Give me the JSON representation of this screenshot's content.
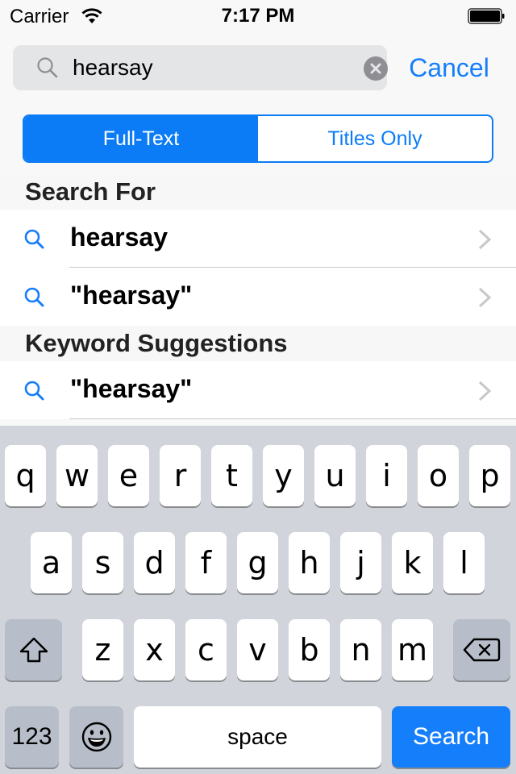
{
  "status_bar": {
    "carrier": "Carrier",
    "time": "7:17 PM",
    "wifi_icon": "wifi-icon",
    "battery_icon": "battery-full-icon"
  },
  "search": {
    "value": "hearsay",
    "placeholder": "Search",
    "search_icon": "magnifier-icon",
    "clear_icon": "clear-x-icon",
    "cancel_label": "Cancel"
  },
  "scope": {
    "options": [
      "Full-Text",
      "Titles Only"
    ],
    "selected": "Full-Text"
  },
  "sections": [
    {
      "header": "Search For",
      "items": [
        {
          "label": "hearsay",
          "icon": "search-icon",
          "accessory": "chevron-right-icon"
        },
        {
          "label": "\"hearsay\"",
          "icon": "search-icon",
          "accessory": "chevron-right-icon"
        }
      ]
    },
    {
      "header": "Keyword Suggestions",
      "items": [
        {
          "label": "\"hearsay\"",
          "icon": "search-icon",
          "accessory": "chevron-right-icon"
        }
      ]
    }
  ],
  "keyboard": {
    "row1": [
      "q",
      "w",
      "e",
      "r",
      "t",
      "y",
      "u",
      "i",
      "o",
      "p"
    ],
    "row2": [
      "a",
      "s",
      "d",
      "f",
      "g",
      "h",
      "j",
      "k",
      "l"
    ],
    "row3": [
      "z",
      "x",
      "c",
      "v",
      "b",
      "n",
      "m"
    ],
    "shift_icon": "shift-icon",
    "backspace_icon": "backspace-icon",
    "numbers_label": "123",
    "emoji_icon": "emoji-icon",
    "space_label": "space",
    "return_label": "Search"
  },
  "colors": {
    "accent": "#157efb",
    "keyboard_bg": "#d1d5db",
    "function_key": "#b7bec9"
  }
}
